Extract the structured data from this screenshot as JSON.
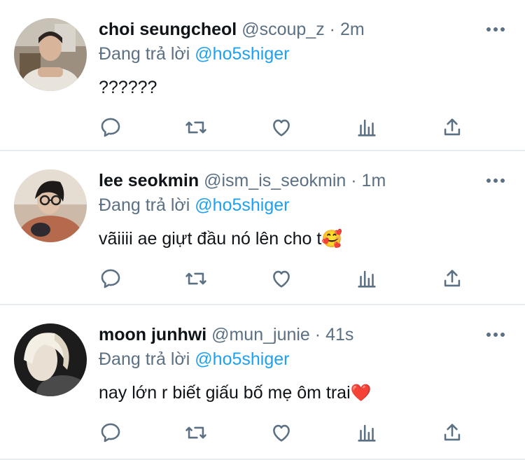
{
  "colors": {
    "text": "#0f1419",
    "secondary": "#5b7083",
    "link": "#1da1f2",
    "divider": "#e6ecf0"
  },
  "icons": [
    "reply-icon",
    "retweet-icon",
    "like-icon",
    "stats-icon",
    "share-icon",
    "more-icon"
  ],
  "tweets": [
    {
      "name": "choi seungcheol",
      "handle": "@scoup_z",
      "dot": "·",
      "time": "2m",
      "replying_prefix": "Đang trả lời",
      "replying_to": "@ho5shiger",
      "text": "??????",
      "emoji": ""
    },
    {
      "name": "lee seokmin",
      "handle": "@ism_is_seokmin",
      "dot": "·",
      "time": "1m",
      "replying_prefix": "Đang trả lời",
      "replying_to": "@ho5shiger",
      "text": "vãiiii ae giựt đầu nó lên cho t",
      "emoji": "🥰"
    },
    {
      "name": "moon junhwi",
      "handle": "@mun_junie",
      "dot": "·",
      "time": "41s",
      "replying_prefix": "Đang trả lời",
      "replying_to": "@ho5shiger",
      "text": "nay lớn r biết giấu bố mẹ ôm trai",
      "emoji": "❤️"
    }
  ]
}
